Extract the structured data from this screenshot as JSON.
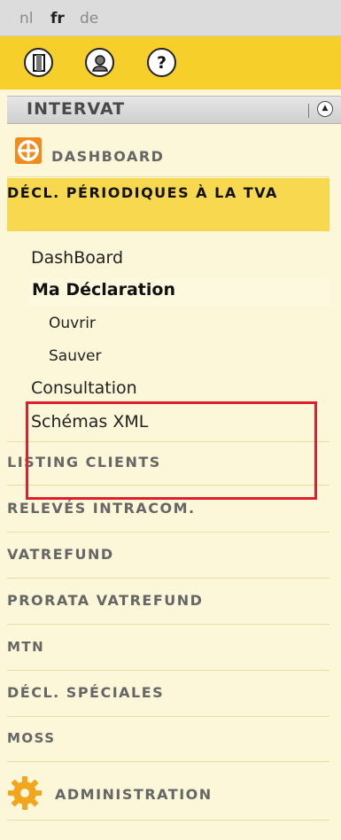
{
  "languages": [
    "nl",
    "fr",
    "de"
  ],
  "toolbar": {
    "logout_glyph": "⏻",
    "user_glyph": "👤",
    "help_glyph": "?"
  },
  "app": {
    "title": "INTERVAT",
    "collapse_glyph": "▲"
  },
  "menu": {
    "dashboard": "DASHBOARD",
    "decl_periodiques": "DÉCL. PÉRIODIQUES À LA TVA",
    "sub_dashboard": "DashBoard",
    "ma_declaration": "Ma Déclaration",
    "ouvrir": "Ouvrir",
    "sauver": "Sauver",
    "consultation": "Consultation",
    "schemas_xml": "Schémas XML",
    "listing_clients": "LISTING CLIENTS",
    "releves_intracom": "RELEVÉS INTRACOM.",
    "vatrefund": "VATREFUND",
    "prorata_vatrefund": "PRORATA VATREFUND",
    "mtn": "MTN",
    "decl_speciales": "DÉCL. SPÉCIALES",
    "moss": "MOSS",
    "administration": "ADMINISTRATION"
  },
  "colors": {
    "accent_yellow": "#f6cf2a",
    "active_section": "#f7d84e",
    "highlight_box": "#e01e2e",
    "dashboard_icon": "#f28b1c",
    "admin_gear": "#f3a51d"
  }
}
